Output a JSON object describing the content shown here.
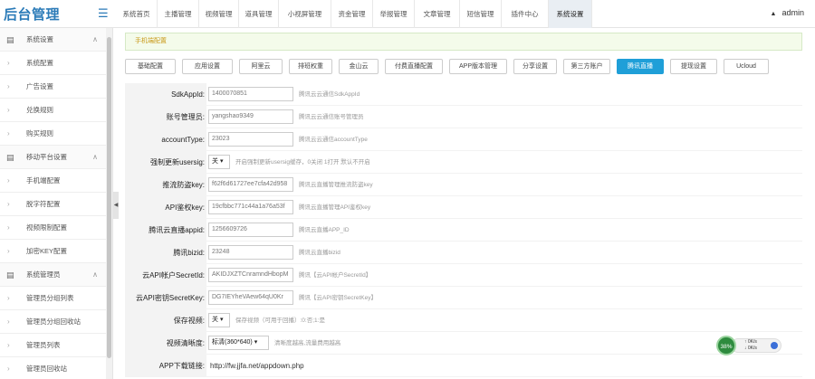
{
  "app_title": "后台管理",
  "topnav": [
    {
      "label": "系统首页",
      "active": false
    },
    {
      "label": "主播管理",
      "active": false
    },
    {
      "label": "视频管理",
      "active": false
    },
    {
      "label": "道具管理",
      "active": false
    },
    {
      "label": "小视屏管理",
      "active": false
    },
    {
      "label": "资金管理",
      "active": false
    },
    {
      "label": "举报管理",
      "active": false
    },
    {
      "label": "文章管理",
      "active": false
    },
    {
      "label": "短信管理",
      "active": false
    },
    {
      "label": "插件中心",
      "active": false
    },
    {
      "label": "系统设置",
      "active": true
    }
  ],
  "user": {
    "name": "admin"
  },
  "sidebar": [
    {
      "type": "group",
      "label": "系统设置",
      "icon": "document-icon"
    },
    {
      "type": "item",
      "label": "系统配置"
    },
    {
      "type": "item",
      "label": "广告设置"
    },
    {
      "type": "item",
      "label": "兑换规则"
    },
    {
      "type": "item",
      "label": "购买规则"
    },
    {
      "type": "group",
      "label": "移动平台设置",
      "icon": "document-icon"
    },
    {
      "type": "item",
      "label": "手机端配置"
    },
    {
      "type": "item",
      "label": "脱字符配置"
    },
    {
      "type": "item",
      "label": "视频限制配置"
    },
    {
      "type": "item",
      "label": "加密KEY配置"
    },
    {
      "type": "group",
      "label": "系统管理员",
      "icon": "document-icon"
    },
    {
      "type": "item",
      "label": "管理员分组列表"
    },
    {
      "type": "item",
      "label": "管理员分组回收站"
    },
    {
      "type": "item",
      "label": "管理员列表"
    },
    {
      "type": "item",
      "label": "管理员回收站"
    }
  ],
  "alert": {
    "text": "手机端配置"
  },
  "config_tabs": [
    {
      "label": "基础配置",
      "active": false
    },
    {
      "label": "应用设置",
      "active": false
    },
    {
      "label": "阿里云",
      "active": false
    },
    {
      "label": "排班权重",
      "active": false
    },
    {
      "label": "金山云",
      "active": false
    },
    {
      "label": "付费直播配置",
      "active": false
    },
    {
      "label": "APP版本管理",
      "active": false
    },
    {
      "label": "分享设置",
      "active": false
    },
    {
      "label": "第三方账户",
      "active": false
    },
    {
      "label": "腾讯直播",
      "active": true
    },
    {
      "label": "提现设置",
      "active": false
    },
    {
      "label": "Ucloud",
      "active": false
    }
  ],
  "form": [
    {
      "label": "SdkAppId:",
      "kind": "input",
      "value": "1400070851",
      "hint": "腾讯云云通信SdkAppId"
    },
    {
      "label": "账号管理员:",
      "kind": "input",
      "value": "yangshao9349",
      "hint": "腾讯云云通信账号管理员"
    },
    {
      "label": "accountType:",
      "kind": "input",
      "value": "23023",
      "hint": "腾讯云云通信accountType"
    },
    {
      "label": "强制更新usersig:",
      "kind": "select",
      "value": "关",
      "hint": "开启强制更新usersig缓存，0关闭 1打开 默认不开启"
    },
    {
      "label": "推流防盗key:",
      "kind": "input",
      "value": "f62f6d61727ee7cfa42d958",
      "hint": "腾讯云直播管理推流防盗key"
    },
    {
      "label": "API鉴权key:",
      "kind": "input",
      "value": "19cfbbc771c44a1a76a53f",
      "hint": "腾讯云直播管理API鉴权key"
    },
    {
      "label": "腾讯云直播appid:",
      "kind": "input",
      "value": "1256609726",
      "hint": "腾讯云直播APP_ID"
    },
    {
      "label": "腾讯bizid:",
      "kind": "input",
      "value": "23248",
      "hint": "腾讯云直播bizid"
    },
    {
      "label": "云API帐户SecretId:",
      "kind": "input",
      "value": "AKIDJXZTCnramndHbopM",
      "hint": "腾讯【云API帐户SecretId】"
    },
    {
      "label": "云API密钥SecretKey:",
      "kind": "input",
      "value": "DG7IEYheVAew64qU0Kr",
      "hint": "腾讯【云API密钥SecretKey】"
    },
    {
      "label": "保存视频:",
      "kind": "select",
      "value": "关",
      "hint": "保存视频（可用于回播）:0:否;1:是"
    },
    {
      "label": "视频清晰度:",
      "kind": "select2",
      "value": "标清(360*640)",
      "hint": "清晰度越高,流量费用越高"
    },
    {
      "label": "APP下载链接:",
      "kind": "plain",
      "value": "http://fw.jjfa.net/appdown.php",
      "hint": ""
    }
  ],
  "net_widget": {
    "percent": "38%",
    "up": "0K/s",
    "down": "0K/s"
  }
}
